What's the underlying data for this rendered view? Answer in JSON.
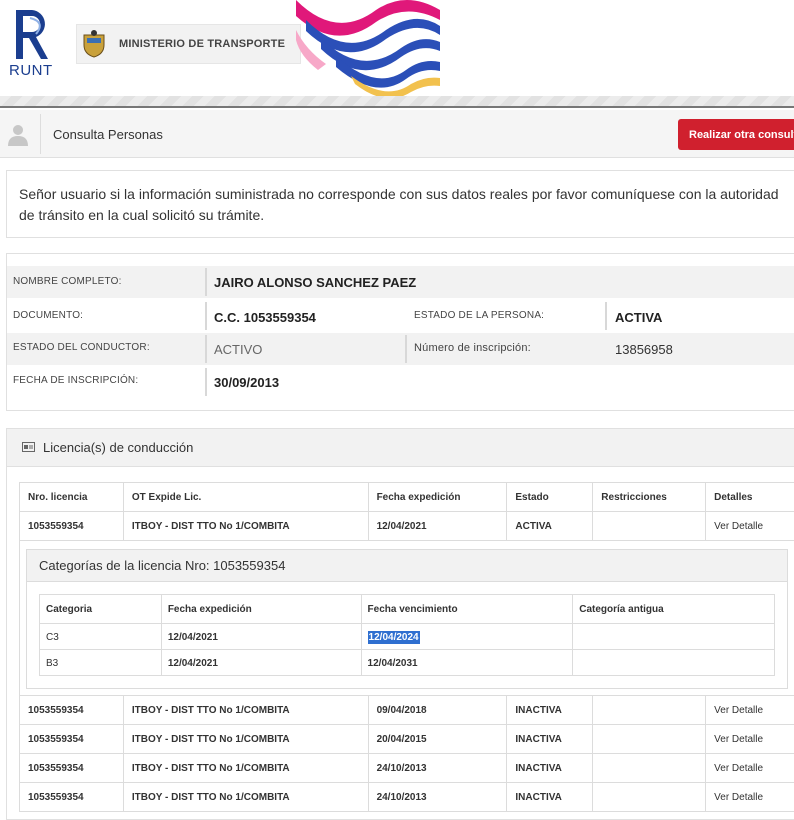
{
  "header": {
    "logo_text": "RUNT",
    "ministerio": "MINISTERIO DE TRANSPORTE"
  },
  "topbar": {
    "title": "Consulta Personas",
    "button": "Realizar otra consulta"
  },
  "notice": "Señor usuario si la información suministrada no corresponde con sus datos reales por favor comuníquese con la autoridad de tránsito en la cual solicitó su trámite.",
  "persona": {
    "nombre_label": "NOMBRE COMPLETO:",
    "nombre": "JAIRO ALONSO SANCHEZ PAEZ",
    "documento_label": "DOCUMENTO:",
    "documento": "C.C. 1053559354",
    "estado_persona_label": "ESTADO DE LA PERSONA:",
    "estado_persona": "ACTIVA",
    "estado_conductor_label": "ESTADO DEL CONDUCTOR:",
    "estado_conductor": "ACTIVO",
    "inscripcion_label": "Número de inscripción:",
    "inscripcion": "13856958",
    "fecha_label": "FECHA DE INSCRIPCIÓN:",
    "fecha": "30/09/2013"
  },
  "licencias": {
    "title": "Licencia(s) de conducción",
    "columns": [
      "Nro. licencia",
      "OT Expide Lic.",
      "Fecha expedición",
      "Estado",
      "Restricciones",
      "Detalles"
    ],
    "first": {
      "nro": "1053559354",
      "ot": "ITBOY - DIST TTO No 1/COMBITA",
      "fecha": "12/04/2021",
      "estado": "ACTIVA",
      "restricciones": "",
      "detalles": "Ver Detalle"
    },
    "categorias": {
      "title": "Categorías de la licencia Nro: 1053559354",
      "columns": [
        "Categoria",
        "Fecha expedición",
        "Fecha vencimiento",
        "Categoría antigua"
      ],
      "rows": [
        {
          "cat": "C3",
          "exp": "12/04/2021",
          "venc": "12/04/2024",
          "antigua": ""
        },
        {
          "cat": "B3",
          "exp": "12/04/2021",
          "venc": "12/04/2031",
          "antigua": ""
        }
      ]
    },
    "rest": [
      {
        "nro": "1053559354",
        "ot": "ITBOY - DIST TTO No 1/COMBITA",
        "fecha": "09/04/2018",
        "estado": "INACTIVA",
        "restricciones": "",
        "detalles": "Ver Detalle"
      },
      {
        "nro": "1053559354",
        "ot": "ITBOY - DIST TTO No 1/COMBITA",
        "fecha": "20/04/2015",
        "estado": "INACTIVA",
        "restricciones": "",
        "detalles": "Ver Detalle"
      },
      {
        "nro": "1053559354",
        "ot": "ITBOY - DIST TTO No 1/COMBITA",
        "fecha": "24/10/2013",
        "estado": "INACTIVA",
        "restricciones": "",
        "detalles": "Ver Detalle"
      },
      {
        "nro": "1053559354",
        "ot": "ITBOY - DIST TTO No 1/COMBITA",
        "fecha": "24/10/2013",
        "estado": "INACTIVA",
        "restricciones": "",
        "detalles": "Ver Detalle"
      }
    ]
  },
  "colors": {
    "accent_red": "#d0202e",
    "runt_blue": "#1b3e8f",
    "highlight": "#2f6fd0"
  }
}
